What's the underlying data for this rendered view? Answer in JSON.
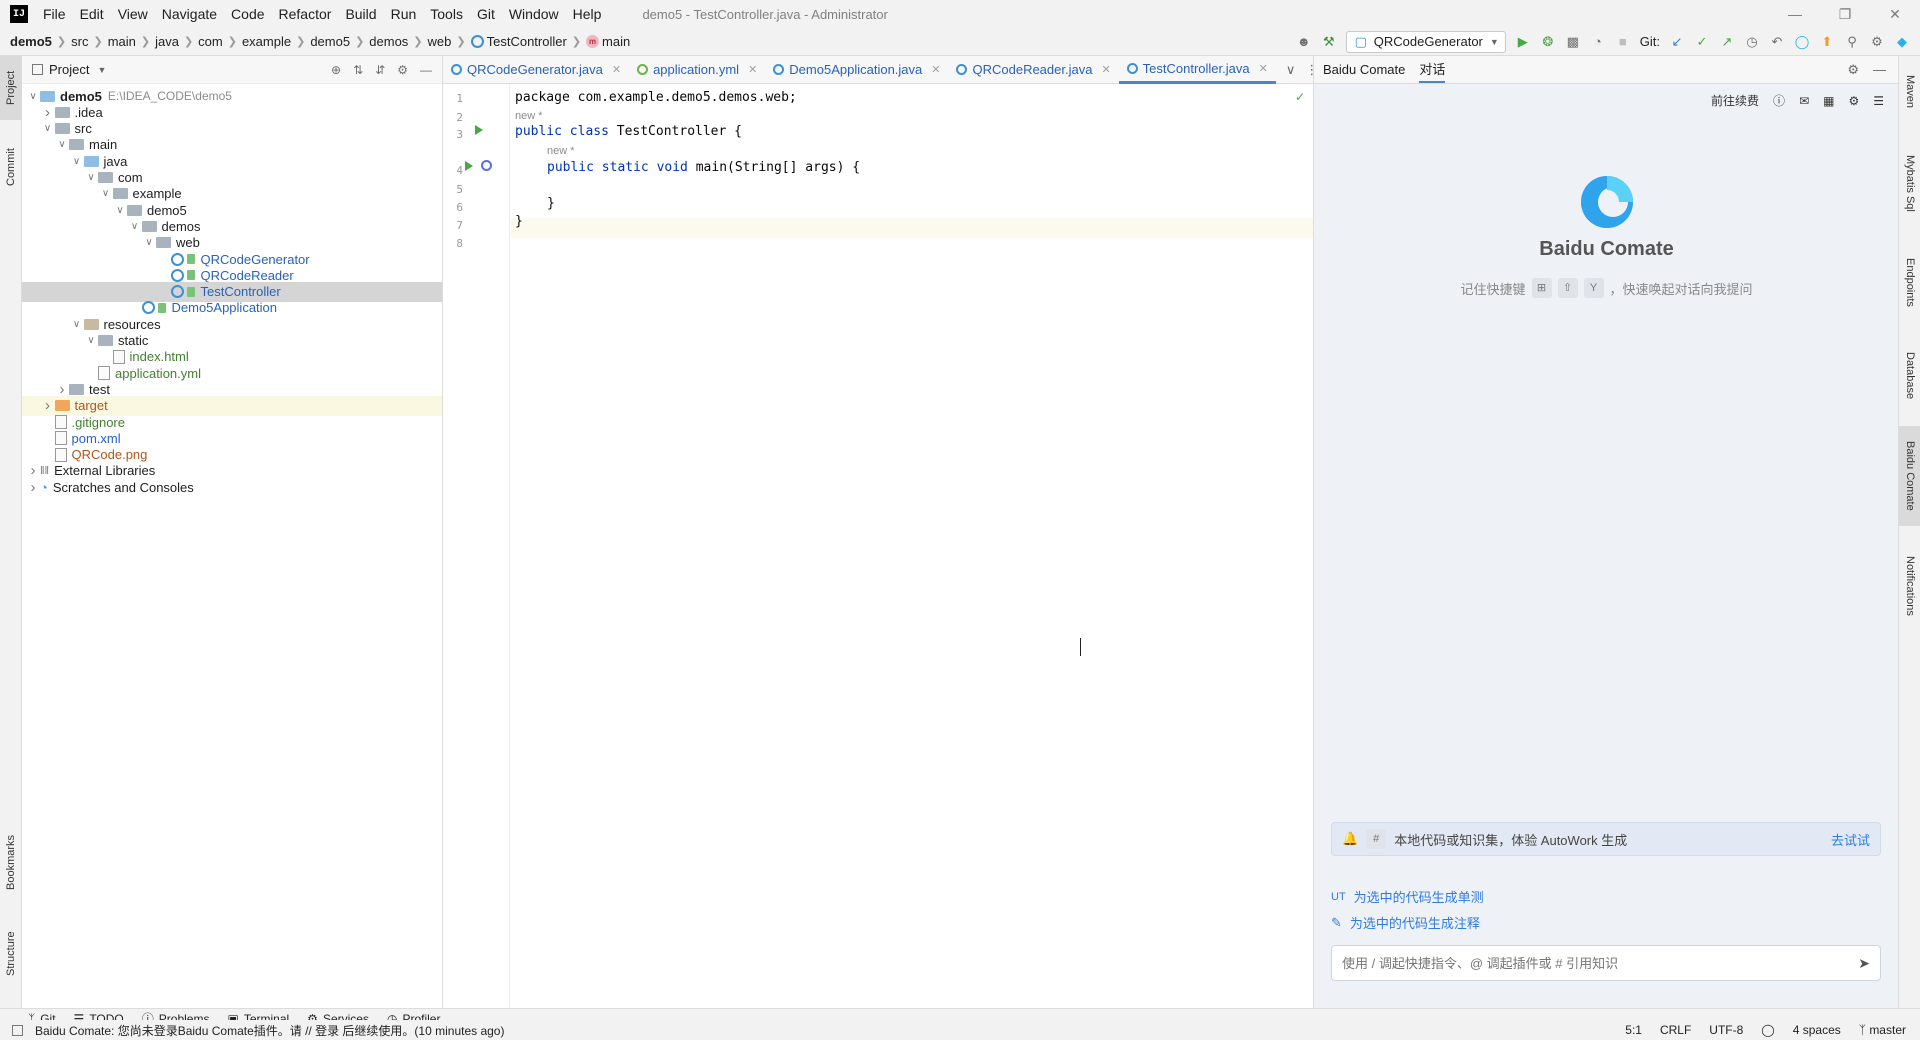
{
  "menubar": {
    "items": [
      "File",
      "Edit",
      "View",
      "Navigate",
      "Code",
      "Refactor",
      "Build",
      "Run",
      "Tools",
      "Git",
      "Window",
      "Help"
    ],
    "window_title": "demo5 - TestController.java - Administrator"
  },
  "breadcrumb": [
    "demo5",
    "src",
    "main",
    "java",
    "com",
    "example",
    "demo5",
    "demos",
    "web",
    "TestController",
    "main"
  ],
  "toolbar": {
    "run_config": "QRCodeGenerator",
    "git_label": "Git:"
  },
  "left_strip": [
    "Project",
    "Commit",
    "Bookmarks",
    "Structure"
  ],
  "right_strip": [
    "Maven",
    "Mybatis Sql",
    "Endpoints",
    "Database",
    "Baidu Comate",
    "Notifications"
  ],
  "project": {
    "title": "Project",
    "tree": [
      {
        "label": "demo5",
        "path": "E:\\IDEA_CODE\\demo5",
        "depth": 0,
        "chev": "down",
        "icon": "folder-src",
        "bold": true
      },
      {
        "label": ".idea",
        "depth": 1,
        "chev": "right",
        "icon": "folder"
      },
      {
        "label": "src",
        "depth": 1,
        "chev": "down",
        "icon": "folder"
      },
      {
        "label": "main",
        "depth": 2,
        "chev": "down",
        "icon": "folder"
      },
      {
        "label": "java",
        "depth": 3,
        "chev": "down",
        "icon": "folder-src"
      },
      {
        "label": "com",
        "depth": 4,
        "chev": "down",
        "icon": "folder"
      },
      {
        "label": "example",
        "depth": 5,
        "chev": "down",
        "icon": "folder"
      },
      {
        "label": "demo5",
        "depth": 6,
        "chev": "down",
        "icon": "folder"
      },
      {
        "label": "demos",
        "depth": 7,
        "chev": "down",
        "icon": "folder"
      },
      {
        "label": "web",
        "depth": 8,
        "chev": "down",
        "icon": "folder"
      },
      {
        "label": "QRCodeGenerator",
        "depth": 9,
        "icon": "java",
        "color": "blue"
      },
      {
        "label": "QRCodeReader",
        "depth": 9,
        "icon": "java",
        "color": "blue"
      },
      {
        "label": "TestController",
        "depth": 9,
        "icon": "java",
        "color": "blue",
        "selected": true
      },
      {
        "label": "Demo5Application",
        "depth": 7,
        "icon": "java",
        "color": "blue"
      },
      {
        "label": "resources",
        "depth": 3,
        "chev": "down",
        "icon": "folder-res"
      },
      {
        "label": "static",
        "depth": 4,
        "chev": "down",
        "icon": "folder"
      },
      {
        "label": "index.html",
        "depth": 5,
        "icon": "file",
        "color": "green"
      },
      {
        "label": "application.yml",
        "depth": 4,
        "icon": "file",
        "color": "green"
      },
      {
        "label": "test",
        "depth": 2,
        "chev": "right",
        "icon": "folder"
      },
      {
        "label": "target",
        "depth": 1,
        "chev": "right",
        "icon": "folder-tgt",
        "color": "orange",
        "highlight": true
      },
      {
        "label": ".gitignore",
        "depth": 1,
        "icon": "file",
        "color": "green"
      },
      {
        "label": "pom.xml",
        "depth": 1,
        "icon": "file",
        "color": "blue"
      },
      {
        "label": "QRCode.png",
        "depth": 1,
        "icon": "file",
        "color": "orange"
      },
      {
        "label": "External Libraries",
        "depth": 0,
        "chev": "right",
        "icon": "libs"
      },
      {
        "label": "Scratches and Consoles",
        "depth": 0,
        "chev": "right",
        "icon": "scratch"
      }
    ]
  },
  "editor_tabs": [
    {
      "label": "QRCodeGenerator.java",
      "icon": "java"
    },
    {
      "label": "application.yml",
      "icon": "yml"
    },
    {
      "label": "Demo5Application.java",
      "icon": "java"
    },
    {
      "label": "QRCodeReader.java",
      "icon": "java"
    },
    {
      "label": "TestController.java",
      "icon": "java",
      "active": true
    }
  ],
  "code": {
    "line_numbers": [
      "1",
      "2",
      "3",
      "4",
      "5",
      "6",
      "7",
      "8"
    ],
    "l1": "package com.example.demo5.demos.web;",
    "hint1": "new *",
    "l3_kw": "public class",
    "l3_rest": " TestController {",
    "hint2": "new *",
    "l4_kw": "public static void",
    "l4_rest": " main(String[] args) {",
    "l6": "}",
    "l7": "}"
  },
  "comate": {
    "tabs": [
      "Baidu Comate",
      "对话"
    ],
    "top_link": "前往续费",
    "name": "Baidu Comate",
    "tip_prefix": "记住快捷键",
    "keys": [
      "⊞",
      "⇧",
      "Y"
    ],
    "tip_suffix": "，快速唤起对话向我提问",
    "autowork_text": "本地代码或知识集，体验 AutoWork 生成",
    "autowork_hash": "#",
    "autowork_link": "去试试",
    "action_ut_prefix": "UT",
    "action_ut": "为选中的代码生成单测",
    "action_comment": "为选中的代码生成注释",
    "input_placeholder": "使用 / 调起快捷指令、@ 调起插件或 # 引用知识"
  },
  "bottom_tabs": [
    "Git",
    "TODO",
    "Problems",
    "Terminal",
    "Services",
    "Profiler"
  ],
  "status": {
    "message": "Baidu Comate: 您尚未登录Baidu Comate插件。请 // 登录 后继续使用。(10 minutes ago)",
    "position": "5:1",
    "line_sep": "CRLF",
    "encoding": "UTF-8",
    "indent": "4 spaces",
    "branch": "master"
  },
  "colors": {
    "accent": "#2862b9",
    "run_green": "#45a845",
    "comate_bg": "#eef1f6"
  }
}
